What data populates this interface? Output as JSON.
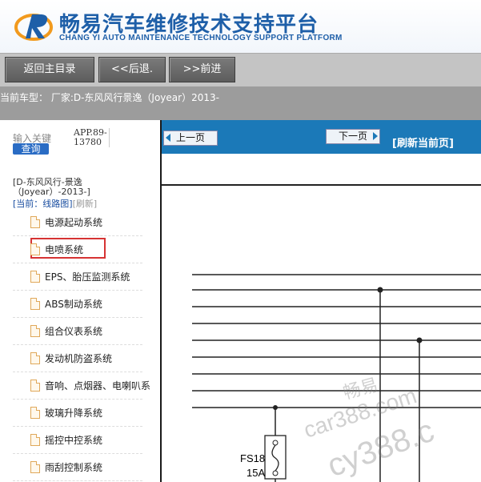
{
  "header": {
    "title": "畅易汽车维修技术支持平台",
    "subtitle": "CHANG YI AUTO MAINTENANCE TECHNOLOGY SUPPORT PLATFORM",
    "brand_color": "#1e5fa8"
  },
  "nav": {
    "home_label": "返回主目录",
    "back_label": "<<后退.",
    "forward_label": ">>前进"
  },
  "car": {
    "text": "当前车型： 厂家:D-东风风行景逸（Joyear）2013-"
  },
  "sidebar": {
    "keyword_label": "输入关键",
    "search_label": "查询",
    "app_code_line1": "APP.89-",
    "app_code_line2": "13780",
    "crumb_line1": "[D-东风风行-景逸",
    "crumb_line2": "（Joyear）-2013-]",
    "current_label": "[当前：线路图]",
    "refresh_label": "[刷新]",
    "items": [
      {
        "label": "电源起动系统"
      },
      {
        "label": "电喷系统"
      },
      {
        "label": "EPS、胎压监测系统"
      },
      {
        "label": "ABS制动系统"
      },
      {
        "label": "组合仪表系统"
      },
      {
        "label": "发动机防盗系统"
      },
      {
        "label": "音响、点烟器、电喇叭系"
      },
      {
        "label": "玻璃升降系统"
      },
      {
        "label": "摇控中控系统"
      },
      {
        "label": "雨刮控制系统"
      }
    ]
  },
  "content": {
    "prev_label": "上一页",
    "next_label": "下一页",
    "refresh_label": "[刷新当前页]",
    "fuse_name": "FS18",
    "fuse_rating": "15A",
    "accent_color": "#1b79b8"
  },
  "watermark": {
    "text1": "畅易",
    "text2": "car388.com",
    "text3": "cy388.c"
  }
}
